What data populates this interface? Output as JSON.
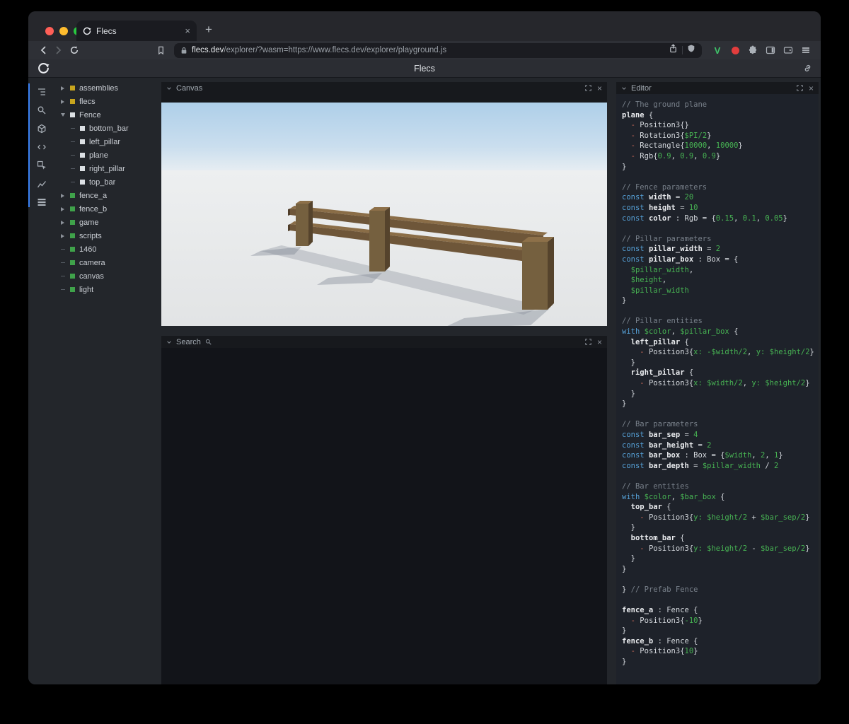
{
  "colors": {
    "accent_blue": "#3b82f6",
    "square_yellow": "#c8a51e",
    "square_green": "#3fa24a",
    "square_white": "#dce0e4",
    "fence_brown": "#6e5639",
    "sky_blue": "#b0d0e9",
    "ground_gray": "#e7e9ea",
    "code_keyword": "#56a0d6",
    "code_variable": "#47b353",
    "code_comment": "#79818b"
  },
  "browser": {
    "tab_title": "Flecs",
    "new_tab_label": "+",
    "close_tab_label": "×",
    "url_host": "flecs.dev",
    "url_path": "/explorer/?wasm=https://www.flecs.dev/explorer/playground.js"
  },
  "app": {
    "title": "Flecs"
  },
  "rail": {
    "icons": [
      "entity-tree-icon",
      "search-icon",
      "queries-icon",
      "code-icon",
      "inspect-icon",
      "stats-icon",
      "data-icon"
    ]
  },
  "panels": {
    "canvas": {
      "title": "Canvas"
    },
    "search": {
      "title": "Search"
    },
    "editor": {
      "title": "Editor"
    }
  },
  "tree": {
    "items": [
      {
        "label": "assemblies",
        "square": "yellow",
        "caret": "right",
        "depth": 0
      },
      {
        "label": "flecs",
        "square": "yellow",
        "caret": "right",
        "depth": 0
      },
      {
        "label": "Fence",
        "square": "white",
        "caret": "down",
        "depth": 0
      },
      {
        "label": "bottom_bar",
        "square": "white",
        "caret": "dash",
        "depth": 1
      },
      {
        "label": "left_pillar",
        "square": "white",
        "caret": "dash",
        "depth": 1
      },
      {
        "label": "plane",
        "square": "white",
        "caret": "dash",
        "depth": 1
      },
      {
        "label": "right_pillar",
        "square": "white",
        "caret": "dash",
        "depth": 1
      },
      {
        "label": "top_bar",
        "square": "white",
        "caret": "dash",
        "depth": 1
      },
      {
        "label": "fence_a",
        "square": "green",
        "caret": "right",
        "depth": 0
      },
      {
        "label": "fence_b",
        "square": "green",
        "caret": "right",
        "depth": 0
      },
      {
        "label": "game",
        "square": "green",
        "caret": "right",
        "depth": 0
      },
      {
        "label": "scripts",
        "square": "green",
        "caret": "right",
        "depth": 0
      },
      {
        "label": "1460",
        "square": "green",
        "caret": "dash",
        "depth": 0
      },
      {
        "label": "camera",
        "square": "green",
        "caret": "dash",
        "depth": 0
      },
      {
        "label": "canvas",
        "square": "green",
        "caret": "dash",
        "depth": 0
      },
      {
        "label": "light",
        "square": "green",
        "caret": "dash",
        "depth": 0
      }
    ]
  },
  "editor": {
    "code": [
      [
        [
          "c",
          "// The ground plane"
        ]
      ],
      [
        [
          "b",
          "plane"
        ],
        [
          "p",
          " {"
        ]
      ],
      [
        [
          "p",
          "  "
        ],
        [
          "d",
          "-"
        ],
        [
          "p",
          " Position3{}"
        ]
      ],
      [
        [
          "p",
          "  "
        ],
        [
          "d",
          "-"
        ],
        [
          "p",
          " Rotation3{"
        ],
        [
          "g",
          "$PI/2"
        ],
        [
          "p",
          "}"
        ]
      ],
      [
        [
          "p",
          "  "
        ],
        [
          "d",
          "-"
        ],
        [
          "p",
          " Rectangle{"
        ],
        [
          "g",
          "10000"
        ],
        [
          "p",
          ", "
        ],
        [
          "g",
          "10000"
        ],
        [
          "p",
          "}"
        ]
      ],
      [
        [
          "p",
          "  "
        ],
        [
          "d",
          "-"
        ],
        [
          "p",
          " Rgb{"
        ],
        [
          "g",
          "0.9"
        ],
        [
          "p",
          ", "
        ],
        [
          "g",
          "0.9"
        ],
        [
          "p",
          ", "
        ],
        [
          "g",
          "0.9"
        ],
        [
          "p",
          "}"
        ]
      ],
      [
        [
          "p",
          "}"
        ]
      ],
      [],
      [
        [
          "c",
          "// Fence parameters"
        ]
      ],
      [
        [
          "k",
          "const"
        ],
        [
          "p",
          " "
        ],
        [
          "b",
          "width"
        ],
        [
          "p",
          " = "
        ],
        [
          "g",
          "20"
        ]
      ],
      [
        [
          "k",
          "const"
        ],
        [
          "p",
          " "
        ],
        [
          "b",
          "height"
        ],
        [
          "p",
          " = "
        ],
        [
          "g",
          "10"
        ]
      ],
      [
        [
          "k",
          "const"
        ],
        [
          "p",
          " "
        ],
        [
          "b",
          "color"
        ],
        [
          "p",
          " : Rgb = {"
        ],
        [
          "g",
          "0.15"
        ],
        [
          "p",
          ", "
        ],
        [
          "g",
          "0.1"
        ],
        [
          "p",
          ", "
        ],
        [
          "g",
          "0.05"
        ],
        [
          "p",
          "}"
        ]
      ],
      [],
      [
        [
          "c",
          "// Pillar parameters"
        ]
      ],
      [
        [
          "k",
          "const"
        ],
        [
          "p",
          " "
        ],
        [
          "b",
          "pillar_width"
        ],
        [
          "p",
          " = "
        ],
        [
          "g",
          "2"
        ]
      ],
      [
        [
          "k",
          "const"
        ],
        [
          "p",
          " "
        ],
        [
          "b",
          "pillar_box"
        ],
        [
          "p",
          " : Box = {"
        ]
      ],
      [
        [
          "p",
          "  "
        ],
        [
          "g",
          "$pillar_width"
        ],
        [
          "p",
          ","
        ]
      ],
      [
        [
          "p",
          "  "
        ],
        [
          "g",
          "$height"
        ],
        [
          "p",
          ","
        ]
      ],
      [
        [
          "p",
          "  "
        ],
        [
          "g",
          "$pillar_width"
        ]
      ],
      [
        [
          "p",
          "}"
        ]
      ],
      [],
      [
        [
          "c",
          "// Pillar entities"
        ]
      ],
      [
        [
          "k",
          "with"
        ],
        [
          "p",
          " "
        ],
        [
          "g",
          "$color"
        ],
        [
          "p",
          ", "
        ],
        [
          "g",
          "$pillar_box"
        ],
        [
          "p",
          " {"
        ]
      ],
      [
        [
          "p",
          "  "
        ],
        [
          "b",
          "left_pillar"
        ],
        [
          "p",
          " {"
        ]
      ],
      [
        [
          "p",
          "    "
        ],
        [
          "d",
          "-"
        ],
        [
          "p",
          " Position3{"
        ],
        [
          "g",
          "x: -$width/2"
        ],
        [
          "p",
          ", "
        ],
        [
          "g",
          "y: $height/2"
        ],
        [
          "p",
          "}"
        ]
      ],
      [
        [
          "p",
          "  }"
        ]
      ],
      [
        [
          "p",
          "  "
        ],
        [
          "b",
          "right_pillar"
        ],
        [
          "p",
          " {"
        ]
      ],
      [
        [
          "p",
          "    "
        ],
        [
          "d",
          "-"
        ],
        [
          "p",
          " Position3{"
        ],
        [
          "g",
          "x: $width/2"
        ],
        [
          "p",
          ", "
        ],
        [
          "g",
          "y: $height/2"
        ],
        [
          "p",
          "}"
        ]
      ],
      [
        [
          "p",
          "  }"
        ]
      ],
      [
        [
          "p",
          "}"
        ]
      ],
      [],
      [
        [
          "c",
          "// Bar parameters"
        ]
      ],
      [
        [
          "k",
          "const"
        ],
        [
          "p",
          " "
        ],
        [
          "b",
          "bar_sep"
        ],
        [
          "p",
          " = "
        ],
        [
          "g",
          "4"
        ]
      ],
      [
        [
          "k",
          "const"
        ],
        [
          "p",
          " "
        ],
        [
          "b",
          "bar_height"
        ],
        [
          "p",
          " = "
        ],
        [
          "g",
          "2"
        ]
      ],
      [
        [
          "k",
          "const"
        ],
        [
          "p",
          " "
        ],
        [
          "b",
          "bar_box"
        ],
        [
          "p",
          " : Box = {"
        ],
        [
          "g",
          "$width"
        ],
        [
          "p",
          ", "
        ],
        [
          "g",
          "2"
        ],
        [
          "p",
          ", "
        ],
        [
          "g",
          "1"
        ],
        [
          "p",
          "}"
        ]
      ],
      [
        [
          "k",
          "const"
        ],
        [
          "p",
          " "
        ],
        [
          "b",
          "bar_depth"
        ],
        [
          "p",
          " = "
        ],
        [
          "g",
          "$pillar_width"
        ],
        [
          "p",
          " / "
        ],
        [
          "g",
          "2"
        ]
      ],
      [],
      [
        [
          "c",
          "// Bar entities"
        ]
      ],
      [
        [
          "k",
          "with"
        ],
        [
          "p",
          " "
        ],
        [
          "g",
          "$color"
        ],
        [
          "p",
          ", "
        ],
        [
          "g",
          "$bar_box"
        ],
        [
          "p",
          " {"
        ]
      ],
      [
        [
          "p",
          "  "
        ],
        [
          "b",
          "top_bar"
        ],
        [
          "p",
          " {"
        ]
      ],
      [
        [
          "p",
          "    "
        ],
        [
          "d",
          "-"
        ],
        [
          "p",
          " Position3{"
        ],
        [
          "g",
          "y: $height/2"
        ],
        [
          "p",
          " + "
        ],
        [
          "g",
          "$bar_sep/2"
        ],
        [
          "p",
          "}"
        ]
      ],
      [
        [
          "p",
          "  }"
        ]
      ],
      [
        [
          "p",
          "  "
        ],
        [
          "b",
          "bottom_bar"
        ],
        [
          "p",
          " {"
        ]
      ],
      [
        [
          "p",
          "    "
        ],
        [
          "d",
          "-"
        ],
        [
          "p",
          " Position3{"
        ],
        [
          "g",
          "y: $height/2"
        ],
        [
          "p",
          " - "
        ],
        [
          "g",
          "$bar_sep/2"
        ],
        [
          "p",
          "}"
        ]
      ],
      [
        [
          "p",
          "  }"
        ]
      ],
      [
        [
          "p",
          "}"
        ]
      ],
      [],
      [
        [
          "p",
          "} "
        ],
        [
          "c",
          "// Prefab Fence"
        ]
      ],
      [],
      [
        [
          "b",
          "fence_a"
        ],
        [
          "p",
          " : Fence {"
        ]
      ],
      [
        [
          "p",
          "  "
        ],
        [
          "d",
          "-"
        ],
        [
          "p",
          " Position3{"
        ],
        [
          "g",
          "-10"
        ],
        [
          "p",
          "}"
        ]
      ],
      [
        [
          "p",
          "}"
        ]
      ],
      [
        [
          "b",
          "fence_b"
        ],
        [
          "p",
          " : Fence {"
        ]
      ],
      [
        [
          "p",
          "  "
        ],
        [
          "d",
          "-"
        ],
        [
          "p",
          " Position3{"
        ],
        [
          "g",
          "10"
        ],
        [
          "p",
          "}"
        ]
      ],
      [
        [
          "p",
          "}"
        ]
      ]
    ]
  }
}
